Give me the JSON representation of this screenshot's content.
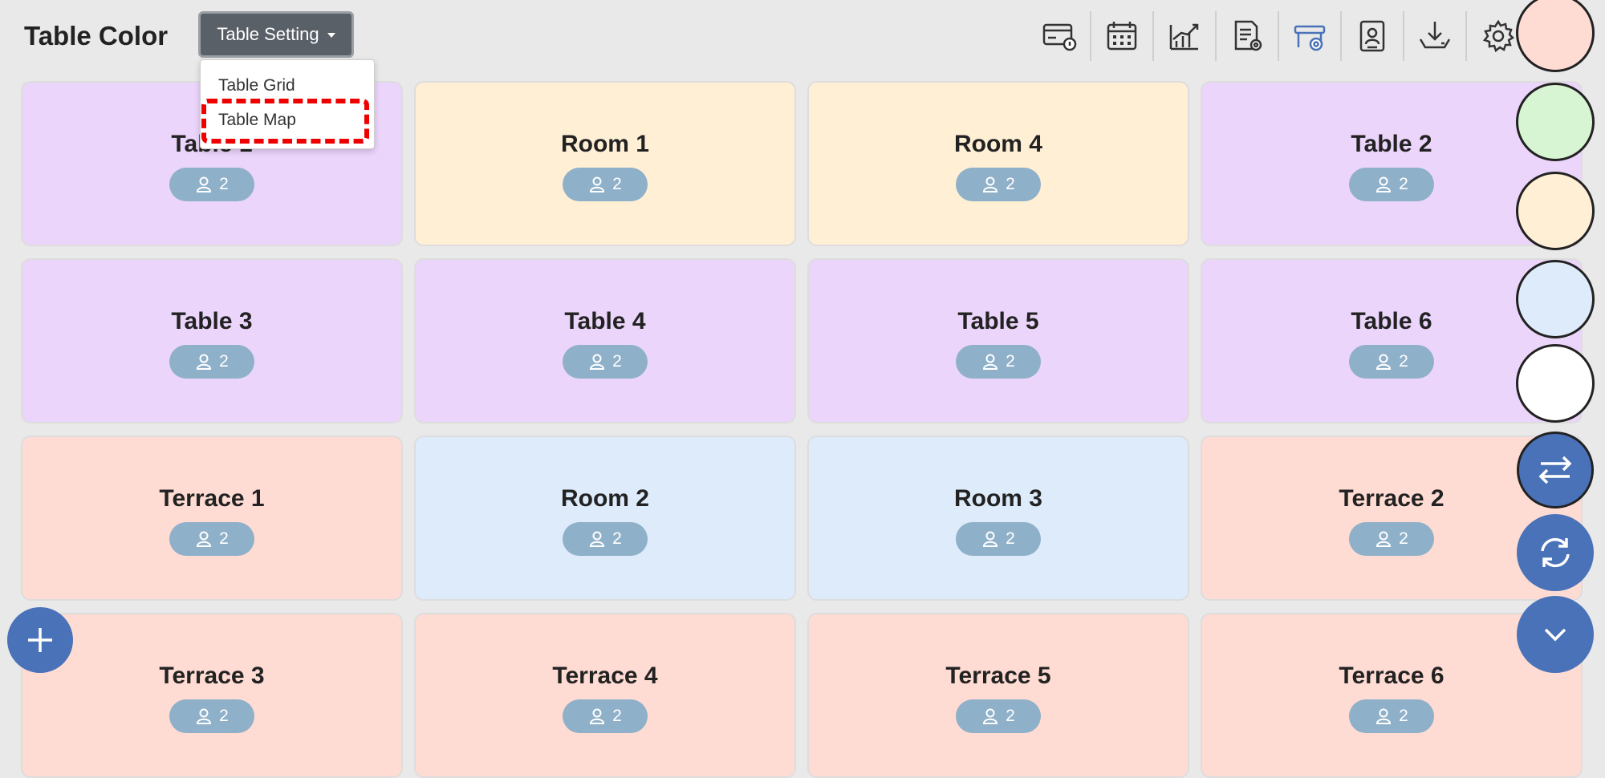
{
  "header": {
    "title": "Table Color",
    "setting_button": "Table Setting",
    "dropdown": {
      "items": [
        "Table Grid",
        "Table Map"
      ]
    }
  },
  "toolbar": {
    "icons": [
      "card-icon",
      "calendar-icon",
      "chart-icon",
      "report-settings-icon",
      "table-settings-icon",
      "contact-icon",
      "download-icon",
      "gear-icon"
    ]
  },
  "tables": [
    {
      "name": "Table 1",
      "guests": "2",
      "color": "#ecd5fb"
    },
    {
      "name": "Room 1",
      "guests": "2",
      "color": "#ffefd5"
    },
    {
      "name": "Room 4",
      "guests": "2",
      "color": "#ffefd5"
    },
    {
      "name": "Table 2",
      "guests": "2",
      "color": "#ecd5fb"
    },
    {
      "name": "Table 3",
      "guests": "2",
      "color": "#ecd5fb"
    },
    {
      "name": "Table 4",
      "guests": "2",
      "color": "#ecd5fb"
    },
    {
      "name": "Table 5",
      "guests": "2",
      "color": "#ecd5fb"
    },
    {
      "name": "Table 6",
      "guests": "2",
      "color": "#ecd5fb"
    },
    {
      "name": "Terrace 1",
      "guests": "2",
      "color": "#ffdcd3"
    },
    {
      "name": "Room 2",
      "guests": "2",
      "color": "#ddebfb"
    },
    {
      "name": "Room 3",
      "guests": "2",
      "color": "#ddebfb"
    },
    {
      "name": "Terrace 2",
      "guests": "2",
      "color": "#ffdcd3"
    },
    {
      "name": "Terrace 3",
      "guests": "2",
      "color": "#ffdcd3"
    },
    {
      "name": "Terrace 4",
      "guests": "2",
      "color": "#ffdcd3"
    },
    {
      "name": "Terrace 5",
      "guests": "2",
      "color": "#ffdcd3"
    },
    {
      "name": "Terrace 6",
      "guests": "2",
      "color": "#ffdcd3"
    }
  ],
  "color_swatches": [
    "#ffdcd3",
    "#d8f5d3",
    "#ffefd5",
    "#ddebfb",
    "#ffffff"
  ],
  "side_actions": [
    "swap-icon",
    "refresh-icon",
    "chevron-down-icon"
  ],
  "colors": {
    "accent": "#4a72b8",
    "badge": "#8fb0c9",
    "highlight": "#e00000"
  }
}
